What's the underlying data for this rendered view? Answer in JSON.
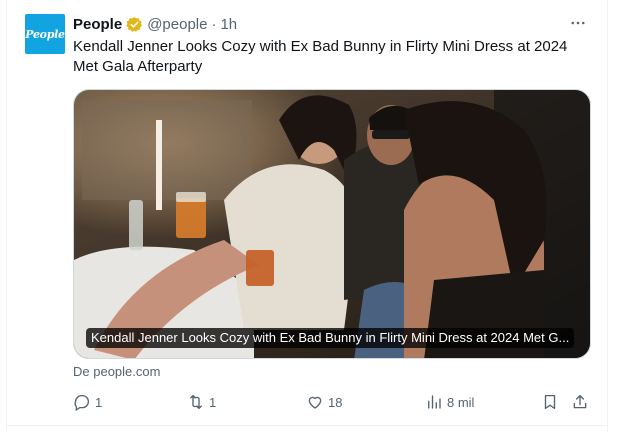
{
  "tweet": {
    "avatar_text": "People",
    "author_name": "People",
    "handle": "@people",
    "separator": "·",
    "time": "1h",
    "text": "Kendall Jenner Looks Cozy with Ex Bad Bunny in Flirty Mini Dress at 2024 Met Gala Afterparty",
    "media_caption": "Kendall Jenner Looks Cozy with Ex Bad Bunny in Flirty Mini Dress at 2024 Met G...",
    "source": "De people.com",
    "more_icon": "more-dots-icon"
  },
  "actions": {
    "reply_count": "1",
    "retweet_count": "1",
    "like_count": "18",
    "views_count": "8 mil"
  },
  "colors": {
    "text": "#0f1419",
    "secondary": "#536471",
    "avatar_bg": "#12a4e1",
    "verified_gold": "#e2b719"
  }
}
